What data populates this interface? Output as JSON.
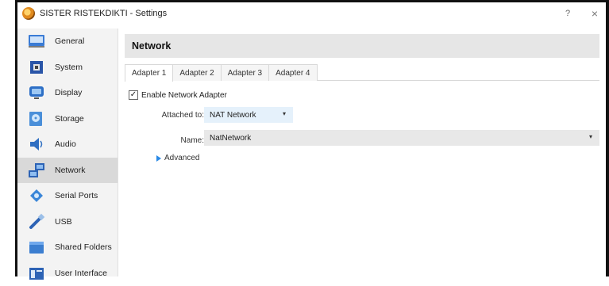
{
  "window": {
    "title": "SISTER RISTEKDIKTI - Settings",
    "help_label": "?",
    "close_label": "×"
  },
  "sidebar": {
    "items": [
      {
        "label": "General",
        "icon": "general-icon"
      },
      {
        "label": "System",
        "icon": "system-icon"
      },
      {
        "label": "Display",
        "icon": "display-icon"
      },
      {
        "label": "Storage",
        "icon": "storage-icon"
      },
      {
        "label": "Audio",
        "icon": "audio-icon"
      },
      {
        "label": "Network",
        "icon": "network-icon",
        "selected": true
      },
      {
        "label": "Serial Ports",
        "icon": "serial-ports-icon"
      },
      {
        "label": "USB",
        "icon": "usb-icon"
      },
      {
        "label": "Shared Folders",
        "icon": "shared-folders-icon"
      },
      {
        "label": "User Interface",
        "icon": "user-interface-icon"
      }
    ]
  },
  "main": {
    "title": "Network",
    "tabs": [
      {
        "label": "Adapter 1",
        "active": true
      },
      {
        "label": "Adapter 2"
      },
      {
        "label": "Adapter 3"
      },
      {
        "label": "Adapter 4"
      }
    ],
    "enable_checkbox": {
      "label": "Enable Network Adapter",
      "checked": true,
      "check_glyph": "✓"
    },
    "attached_to": {
      "label": "Attached to:",
      "value": "NAT Network"
    },
    "name": {
      "label": "Name:",
      "value": "NatNetwork"
    },
    "advanced_label": "Advanced",
    "dropdown_glyph": "▾"
  },
  "colors": {
    "selected_item": "#d9d9d9",
    "header_bg": "#e6e6e6",
    "combo_highlight": "#e5f1fb",
    "accent": "#2b8ae6"
  }
}
